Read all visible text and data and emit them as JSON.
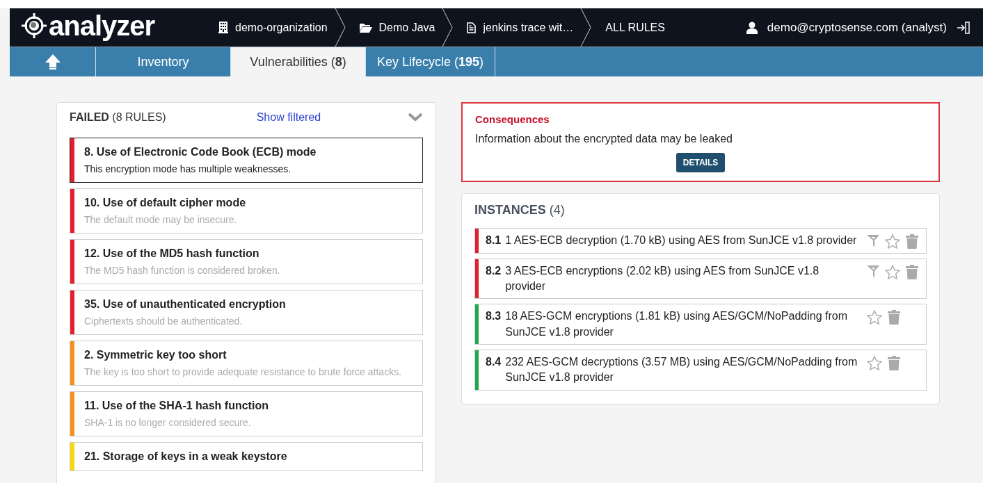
{
  "header": {
    "logo": "analyzer",
    "breadcrumbs": [
      {
        "kind": "organization",
        "label": "demo-organization"
      },
      {
        "kind": "folder",
        "label": "Demo Java"
      },
      {
        "kind": "document",
        "label": "jenkins trace wit…"
      },
      {
        "kind": "plain",
        "label": "ALL RULES"
      }
    ],
    "user": "demo@cryptosense.com (analyst)"
  },
  "tabs": [
    {
      "label": "Inventory",
      "selected": false
    },
    {
      "label": "Vulnerabilities (**8**)",
      "selected": true
    },
    {
      "label": "Key Lifecycle (**195**)",
      "selected": false
    }
  ],
  "rules_panel": {
    "title": "FAILED",
    "count": "(8 RULES)",
    "link": "Show filtered",
    "rules": [
      {
        "title": "8. Use of Electronic Code Book (ECB) mode",
        "description": "This encryption mode has multiple weaknesses.",
        "color": "#e0202c",
        "selected": true
      },
      {
        "title": "10. Use of default cipher mode",
        "description": "The default mode may be insecure.",
        "color": "#e0202c",
        "selected": false
      },
      {
        "title": "12. Use of the MD5 hash function",
        "description": "The MD5 hash function is considered broken.",
        "color": "#e0202c",
        "selected": false
      },
      {
        "title": "35. Use of unauthenticated encryption",
        "description": "Ciphertexts should be authenticated.",
        "color": "#e0202c",
        "selected": false
      },
      {
        "title": "2. Symmetric key too short",
        "description": "The key is too short to provide adequate resistance to brute force attacks.",
        "color": "#f0901e",
        "selected": false
      },
      {
        "title": "11. Use of the SHA-1 hash function",
        "description": "SHA-1 is no longer considered secure.",
        "color": "#f0901e",
        "selected": false
      },
      {
        "title": "21. Storage of keys in a weak keystore",
        "color": "#f5d90a",
        "selected": false
      }
    ]
  },
  "consequences": {
    "title": "Consequences",
    "text": "Information about the encrypted data may be leaked",
    "button": "DETAILS"
  },
  "instances": {
    "title": "INSTANCES",
    "count": "(4)",
    "items": [
      {
        "id": "8.1",
        "text": "1 AES-ECB decryption (1.70 kB) using AES from SunJCE v1.8 provider",
        "color": "#e0202c",
        "filterable": true
      },
      {
        "id": "8.2",
        "text": "3 AES-ECB encryptions (2.02 kB) using AES from SunJCE v1.8 provider",
        "color": "#e0202c",
        "filterable": true
      },
      {
        "id": "8.3",
        "text": "18 AES-GCM encryptions (1.81 kB) using AES/GCM/NoPadding from SunJCE v1.8 provider",
        "color": "#22a84a",
        "filterable": false
      },
      {
        "id": "8.4",
        "text": "232 AES-GCM decryptions (3.57 MB) using AES/GCM/NoPadding from SunJCE v1.8 provider",
        "color": "#22a84a",
        "filterable": false
      }
    ]
  }
}
